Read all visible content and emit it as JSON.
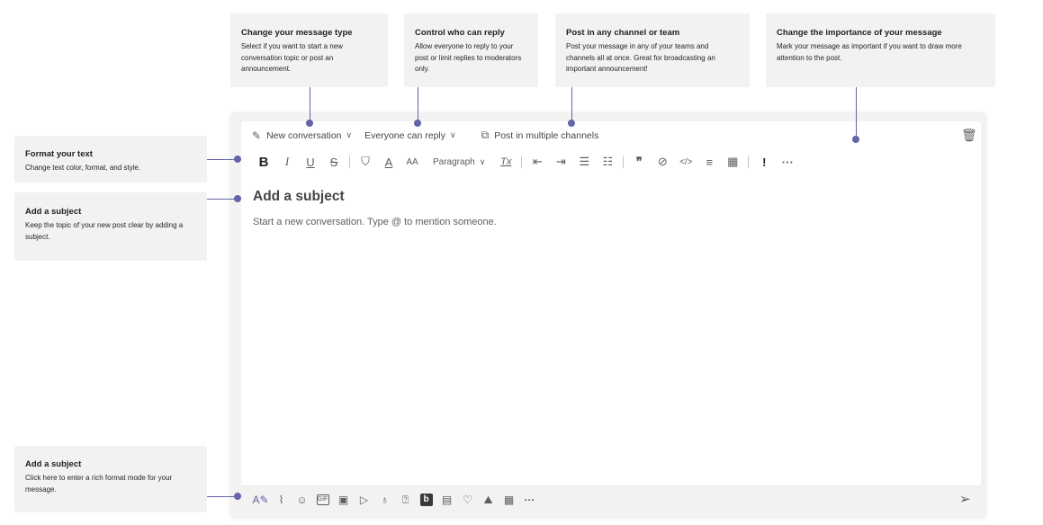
{
  "callouts": {
    "message_type": {
      "title": "Change your message type",
      "body": "Select if you want to start a new conversation topic or post an announcement."
    },
    "who_can_reply": {
      "title": "Control who can reply",
      "body": "Allow everyone to reply to your post or limit replies to moderators only."
    },
    "post_channels": {
      "title": "Post in any channel or team",
      "body": "Post your message in any of your teams and channels all at once. Great for broadcasting an important announcement!"
    },
    "importance": {
      "title": "Change the importance of your message",
      "body": "Mark your message as important if you want to draw more attention to the post."
    },
    "format_text": {
      "title": "Format your text",
      "body": "Change text color, format, and style."
    },
    "add_subject": {
      "title": "Add a subject",
      "body": "Keep the topic of your new post clear by adding a subject."
    },
    "rich_format": {
      "title": "Add a subject",
      "body": "Click here to enter a rich format mode for your message."
    }
  },
  "compose": {
    "options": {
      "new_conversation": "New conversation",
      "everyone_can_reply": "Everyone can reply",
      "post_multiple": "Post in multiple channels"
    },
    "format_toolbar": {
      "bold": "B",
      "italic": "I",
      "underline": "U",
      "strike": "S",
      "highlight": "⛉",
      "font_color": "A",
      "font_size": "AA",
      "paragraph": "Paragraph",
      "clear_format": "Tx",
      "decrease_indent": "⇤",
      "increase_indent": "⇥",
      "bullet_list": "☰",
      "numbered_list": "☷",
      "quote": "❞",
      "link": "⊘",
      "code": "</>",
      "hr": "≡",
      "table": "▦",
      "important": "!",
      "more": "···"
    },
    "subject_placeholder": "Add a subject",
    "body_placeholder": "Start a new conversation. Type @ to mention someone."
  },
  "footer": {
    "icons": {
      "format": "A✎",
      "attach": "⌇",
      "emoji": "☺",
      "gif": "GIF",
      "sticker": "▣",
      "meet": "▷",
      "praise": "♁",
      "stream": "⍰",
      "bing": "b",
      "forms": "▤",
      "heart": "♡",
      "image": "⛰",
      "apps": "▦",
      "more": "···"
    },
    "send": "➢"
  },
  "icons": {
    "trash": "🗑",
    "chevron": "∨",
    "edit": "✎",
    "copy": "⧉"
  },
  "colors": {
    "accent": "#6264a7",
    "callout_bg": "#f3f2f1"
  }
}
